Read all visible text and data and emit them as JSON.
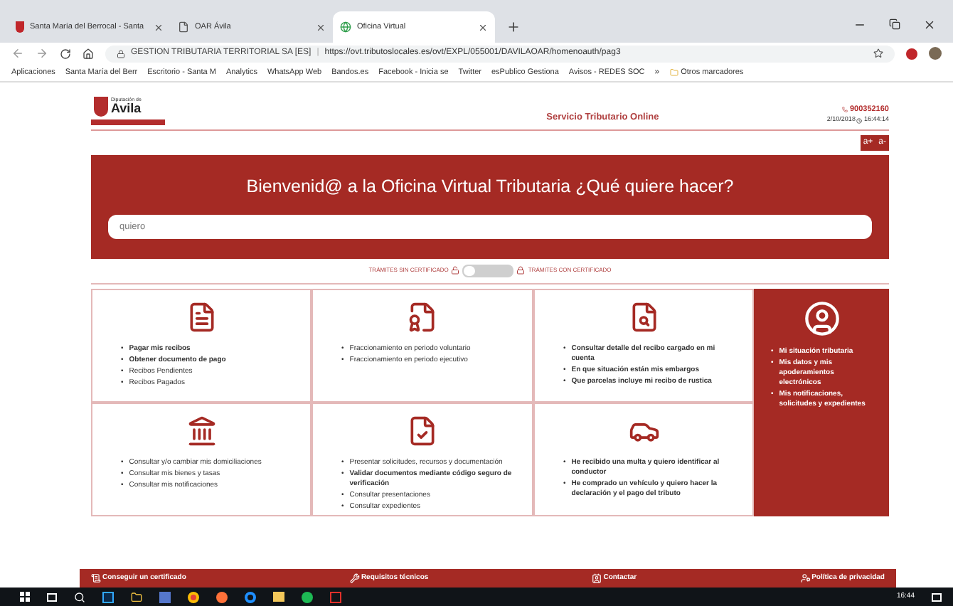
{
  "browser": {
    "tabs": [
      {
        "title": "Santa María del Berrocal - Santa",
        "selected": false
      },
      {
        "title": "OAR Ávila",
        "selected": false
      },
      {
        "title": "Oficina Virtual",
        "selected": true
      }
    ],
    "site_label": "GESTION TRIBUTARIA TERRITORIAL SA [ES]",
    "address_separator": "|",
    "url": "https://ovt.tributoslocales.es/ovt/EXPL/055001/DAVILAOAR/homenoauth/pag3",
    "bookmarks": [
      "Aplicaciones",
      "Santa María del Berr",
      "Escritorio - Santa M",
      "Analytics",
      "WhatsApp Web",
      "Bandos.es",
      "Facebook - Inicia se",
      "Twitter",
      "esPublico Gestiona",
      "Avisos - REDES SOC"
    ],
    "bookmarks_overflow": "»",
    "other_bookmarks": "Otros marcadores"
  },
  "page": {
    "bullet": "•",
    "logo": {
      "small": "Diputación de",
      "name": "Avila"
    },
    "title": "Servicio Tributario Online",
    "phone": "900352160",
    "date": "2/10/2018",
    "time": "16:44:14",
    "font_buttons": [
      "a+",
      "a-"
    ],
    "banner": {
      "heading": "Bienvenid@ a la Oficina Virtual Tributaria ¿Qué quiere hacer?",
      "search_placeholder": "quiero"
    },
    "certificate_toggle": {
      "left_label": "TRÁMITES SIN CERTIFICADO",
      "right_label": "TRÁMITES CON CERTIFICADO",
      "on": false
    },
    "cards": [
      {
        "items": [
          {
            "text": "Pagar mis recibos",
            "bold": true
          },
          {
            "text": "Obtener documento de pago",
            "bold": true
          },
          {
            "text": "Recibos Pendientes",
            "bold": false
          },
          {
            "text": "Recibos Pagados",
            "bold": false
          }
        ]
      },
      {
        "items": [
          {
            "text": "Fraccionamiento en periodo voluntario",
            "bold": false
          },
          {
            "text": "Fraccionamiento en periodo ejecutivo",
            "bold": false
          }
        ]
      },
      {
        "items": [
          {
            "text": "Consultar detalle del recibo cargado en mi cuenta",
            "bold": true
          },
          {
            "text": "En que situación están mis embargos",
            "bold": true
          },
          {
            "text": "Que parcelas incluye mi recibo de rustica",
            "bold": true
          }
        ]
      },
      {
        "items": [
          {
            "text": "Consultar y/o cambiar mis domiciliaciones",
            "bold": false
          },
          {
            "text": "Consultar mis bienes y tasas",
            "bold": false
          },
          {
            "text": "Consultar mis notificaciones",
            "bold": false
          }
        ]
      },
      {
        "items": [
          {
            "text": "Presentar solicitudes, recursos y documentación",
            "bold": false
          },
          {
            "text": "Validar documentos mediante código seguro de verificación",
            "bold": true
          },
          {
            "text": "Consultar presentaciones",
            "bold": false
          },
          {
            "text": "Consultar expedientes",
            "bold": false
          }
        ]
      },
      {
        "items": [
          {
            "text": "He recibido una multa y quiero identificar al conductor",
            "bold": true
          },
          {
            "text": "He comprado un vehículo y quiero hacer la declaración y el pago del tributo",
            "bold": true
          }
        ]
      }
    ],
    "profile_items": [
      "Mi situación tributaria",
      "Mis datos y mis apoderamientos electrónicos",
      "Mis notificaciones, solicitudes y expedientes"
    ],
    "footer_links": [
      "Conseguir un certificado",
      "Requisitos técnicos",
      "Contactar",
      "Política de privacidad"
    ]
  },
  "taskbar": {
    "time": "16:44"
  }
}
